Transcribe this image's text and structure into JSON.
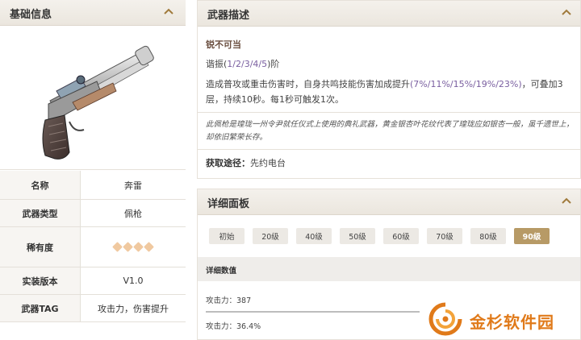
{
  "basic": {
    "title": "基础信息",
    "rows": [
      {
        "key": "名称",
        "value": "奔雷"
      },
      {
        "key": "武器类型",
        "value": "佩枪"
      },
      {
        "key": "稀有度",
        "value": ""
      },
      {
        "key": "实装版本",
        "value": "V1.0"
      },
      {
        "key": "武器TAG",
        "value": "攻击力，伤害提升"
      }
    ],
    "rarity_stars": 4,
    "star_color": "#f0c9a0"
  },
  "weapon_desc": {
    "title": "武器描述",
    "skill_name": "锐不可当",
    "harmony_prefix": "谐振(",
    "harmony_levels": "1/2/3/4/5",
    "harmony_suffix": ")阶",
    "effect_prefix": "造成普攻或重击伤害时，自身共鸣技能伤害加成提升",
    "effect_values": "(7%/11%/15%/19%/23%)",
    "effect_suffix": "，可叠加3层，持续10秒。每1秒可触发1次。",
    "lore": "此佩枪是瑝珑一州令尹就任仪式上使用的典礼武器，黄金银杏叶花纹代表了瑝珑应如银杏一般，虽千遗世上，却依旧繁荣长存。",
    "source_label": "获取途径：",
    "source_value": "先约电台"
  },
  "detail": {
    "title": "详细面板",
    "levels": [
      "初始",
      "20级",
      "40级",
      "50级",
      "60级",
      "70级",
      "80级",
      "90级"
    ],
    "active_level": "90级",
    "stats_header": "详细数值",
    "stats": [
      "攻击力：387",
      "攻击力：36.4%"
    ],
    "accent": "#b79a66"
  },
  "watermark": {
    "text": "金杉软件园"
  }
}
